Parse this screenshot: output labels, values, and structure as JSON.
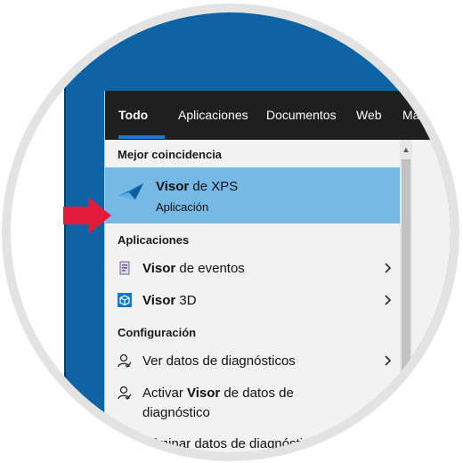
{
  "tabs": [
    {
      "label": "Todo",
      "active": true
    },
    {
      "label": "Aplicaciones",
      "active": false
    },
    {
      "label": "Documentos",
      "active": false
    },
    {
      "label": "Web",
      "active": false
    },
    {
      "label": "Más",
      "active": false
    }
  ],
  "best_match": {
    "header": "Mejor coincidencia",
    "title_bold": "Visor",
    "title_rest": " de XPS",
    "subtitle": "Aplicación",
    "icon": "xps-viewer-icon"
  },
  "apps": {
    "header": "Aplicaciones",
    "items": [
      {
        "bold": "Visor",
        "rest": " de eventos",
        "icon": "event-viewer-icon"
      },
      {
        "bold": "Visor",
        "rest": " 3D",
        "icon": "3d-viewer-icon"
      }
    ]
  },
  "settings": {
    "header": "Configuración",
    "items": [
      {
        "text": "Ver datos de diagnósticos",
        "icon": "person-diagnostics-icon"
      },
      {
        "pre": "Activar ",
        "bold": "Visor",
        "rest": " de datos de",
        "line2": "diagnóstico",
        "icon": "person-diagnostics-icon"
      },
      {
        "text": "Eliminar datos de diagnóstico",
        "icon": "person-diagnostics-icon"
      }
    ]
  },
  "colors": {
    "desktop": "#0e63a4",
    "tab_bar": "#1f1f1f",
    "accent": "#1a78d2",
    "highlight": "#76b9e5",
    "arrow": "#e31b3a"
  }
}
